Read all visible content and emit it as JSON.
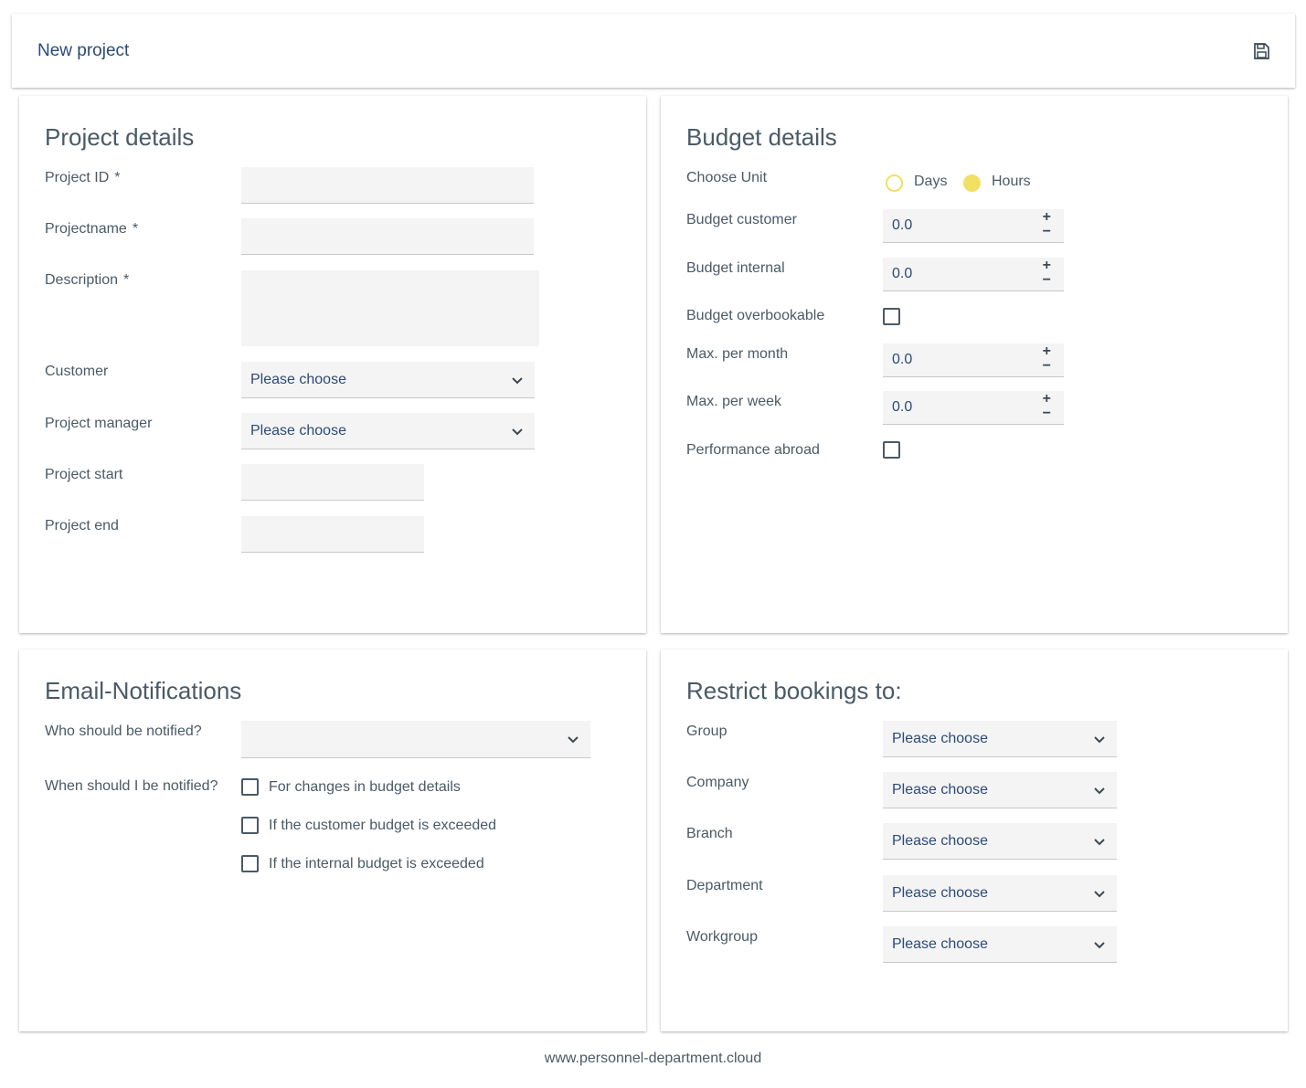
{
  "header": {
    "title": "New project",
    "save_icon": "save-icon"
  },
  "project_details": {
    "title": "Project details",
    "required_mark": "*",
    "project_id_label": "Project ID",
    "projectname_label": "Projectname",
    "description_label": "Description",
    "customer_label": "Customer",
    "customer_value": "Please choose",
    "project_manager_label": "Project manager",
    "project_manager_value": "Please choose",
    "project_start_label": "Project start",
    "project_end_label": "Project end"
  },
  "budget_details": {
    "title": "Budget details",
    "choose_unit_label": "Choose Unit",
    "unit_days": "Days",
    "unit_hours": "Hours",
    "selected_unit": "Hours",
    "budget_customer_label": "Budget customer",
    "budget_customer_value": "0.0",
    "budget_internal_label": "Budget internal",
    "budget_internal_value": "0.0",
    "budget_overbookable_label": "Budget overbookable",
    "max_per_month_label": "Max. per month",
    "max_per_month_value": "0.0",
    "max_per_week_label": "Max. per week",
    "max_per_week_value": "0.0",
    "performance_abroad_label": "Performance abroad",
    "plus_symbol": "+",
    "minus_symbol": "−"
  },
  "email_notifications": {
    "title": "Email-Notifications",
    "who_label": "Who should be notified?",
    "who_value": "",
    "when_label": "When should I be notified?",
    "options": [
      "For changes in budget details",
      "If the customer budget is exceeded",
      "If the internal budget is exceeded"
    ]
  },
  "restrict_bookings": {
    "title": "Restrict bookings to:",
    "group_label": "Group",
    "company_label": "Company",
    "branch_label": "Branch",
    "department_label": "Department",
    "workgroup_label": "Workgroup",
    "placeholder": "Please choose"
  },
  "footer": {
    "text": "www.personnel-department.cloud"
  },
  "colors": {
    "accent_yellow": "#f2e063",
    "title_blue": "#2c4a78",
    "text_gray": "#4a5a66",
    "field_bg": "#f4f4f4"
  }
}
